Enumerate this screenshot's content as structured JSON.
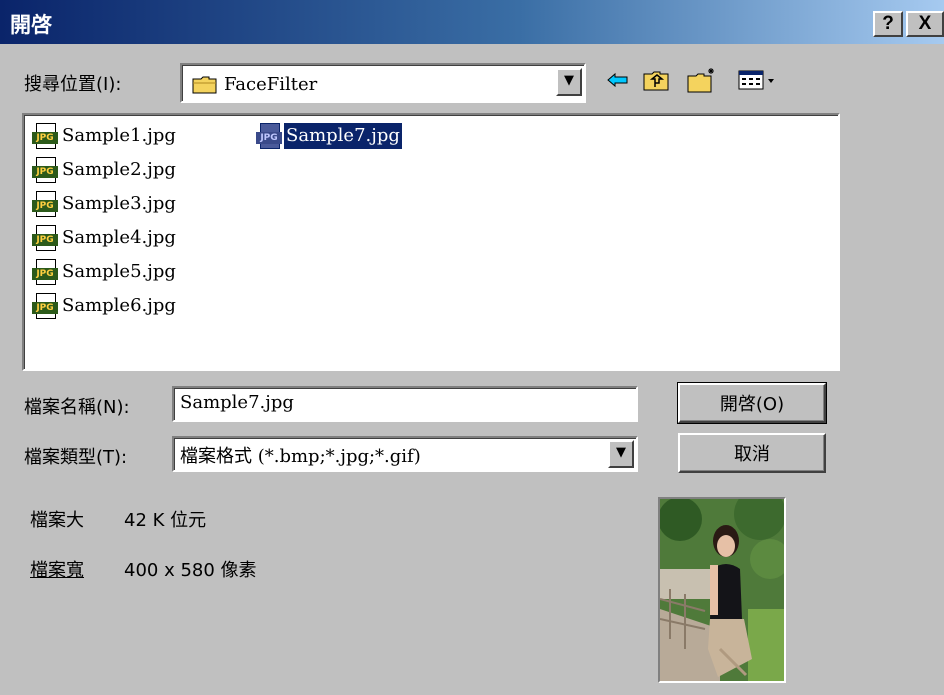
{
  "window": {
    "title": "開啓",
    "help_label": "?",
    "close_label": "X"
  },
  "look_in": {
    "label": "搜尋位置(I):",
    "value": "FaceFilter"
  },
  "toolbar": {
    "back_icon": "back-arrow-icon",
    "up_icon": "up-one-level-icon",
    "new_folder_icon": "new-folder-icon",
    "view_icon": "view-menu-icon"
  },
  "files": [
    {
      "name": "Sample1.jpg",
      "selected": false
    },
    {
      "name": "Sample2.jpg",
      "selected": false
    },
    {
      "name": "Sample3.jpg",
      "selected": false
    },
    {
      "name": "Sample4.jpg",
      "selected": false
    },
    {
      "name": "Sample5.jpg",
      "selected": false
    },
    {
      "name": "Sample6.jpg",
      "selected": false
    },
    {
      "name": "Sample7.jpg",
      "selected": true
    }
  ],
  "file_icon_tag": "JPG",
  "file_name": {
    "label": "檔案名稱(N):",
    "value": "Sample7.jpg"
  },
  "file_type": {
    "label": "檔案類型(T):",
    "value": "檔案格式 (*.bmp;*.jpg;*.gif)"
  },
  "buttons": {
    "open": "開啓(O)",
    "cancel": "取消"
  },
  "info": {
    "size_label": "檔案大",
    "size_value": "42 K 位元",
    "dims_label": "檔案寬",
    "dims_value": "400 x 580 像素"
  },
  "colors": {
    "title_start": "#0a246a",
    "title_end": "#a6caf0",
    "selection": "#0a246a",
    "face": "#c0c0c0"
  }
}
